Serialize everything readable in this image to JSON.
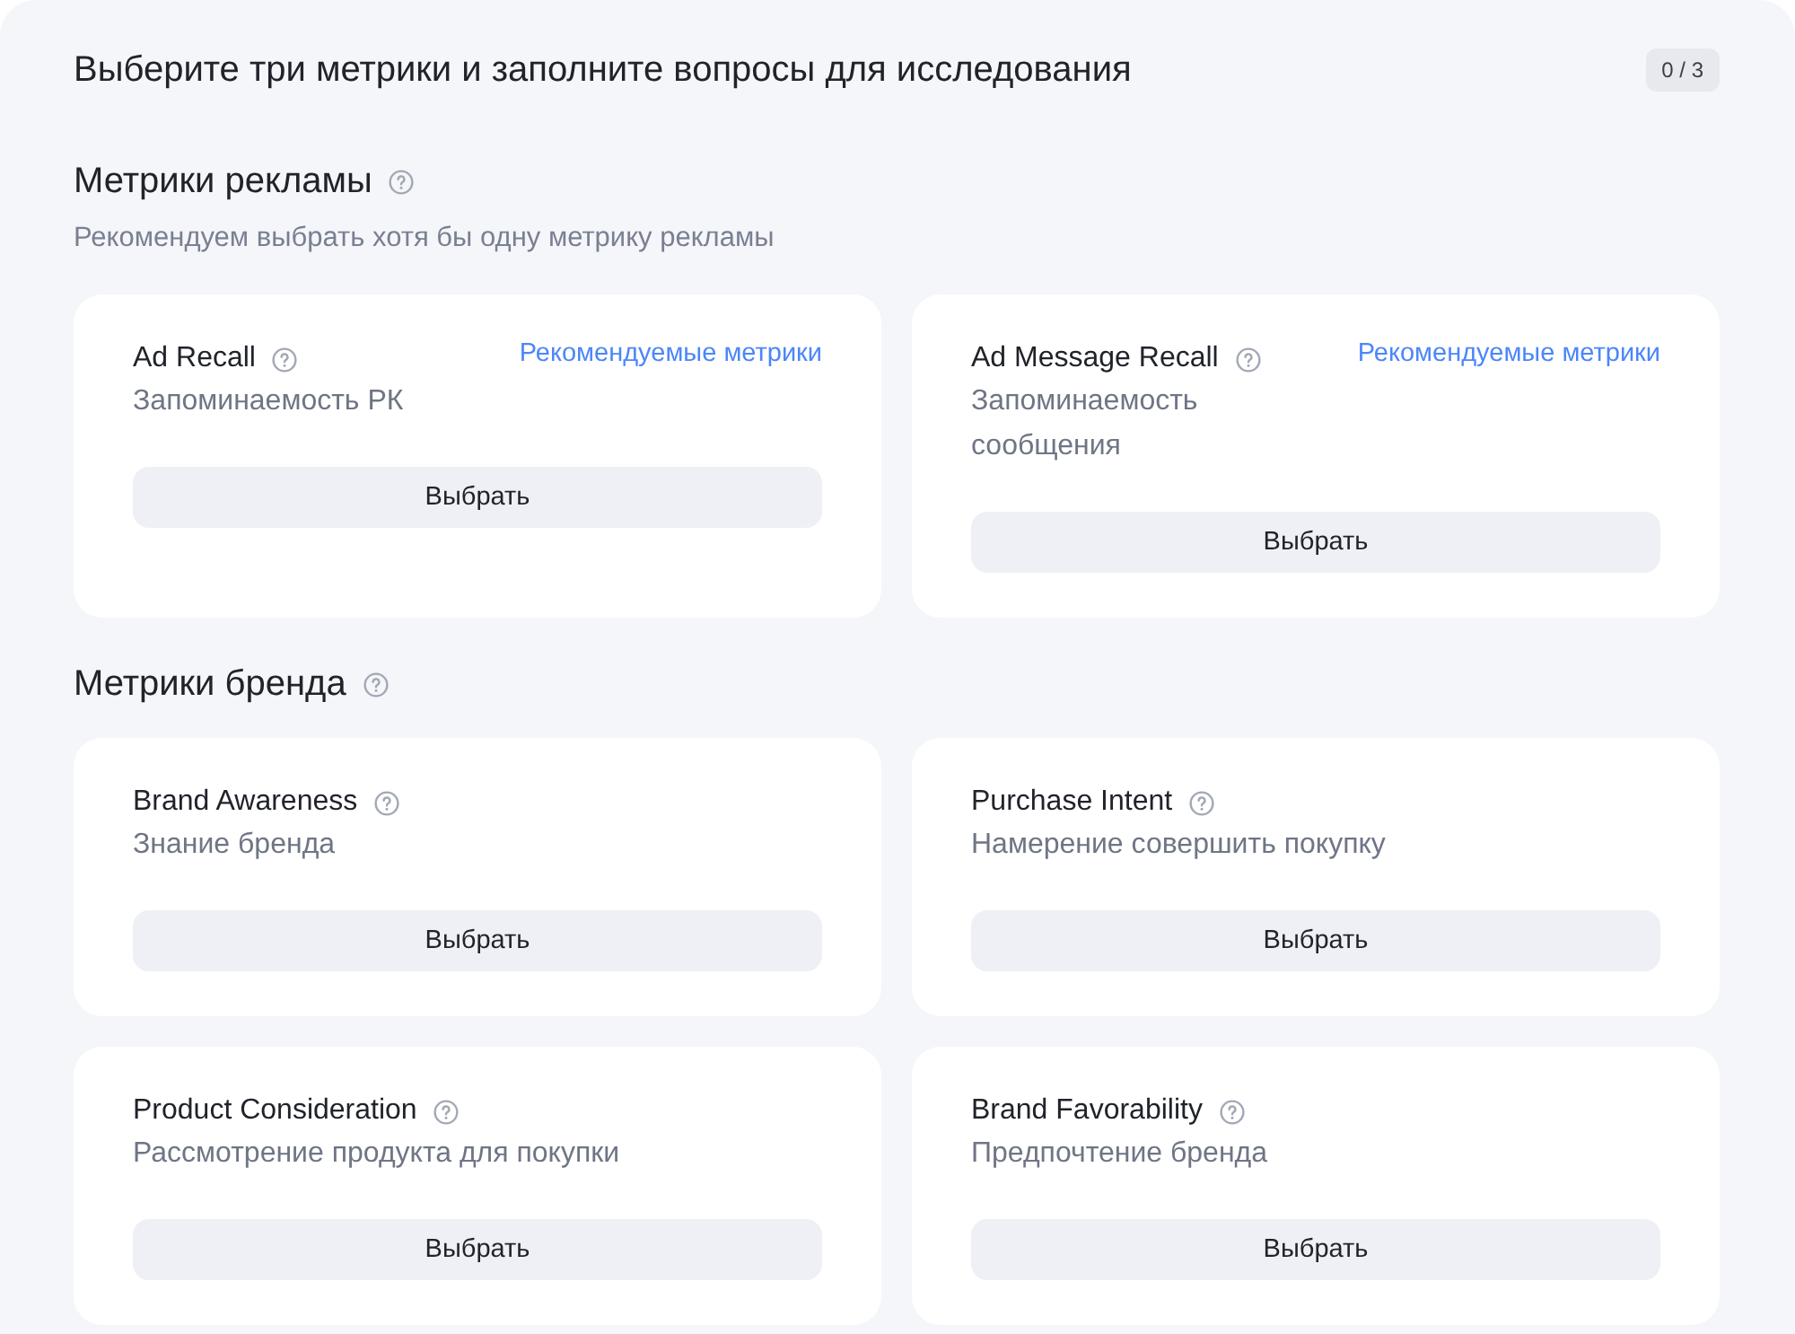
{
  "header": {
    "title": "Выберите три метрики и заполните вопросы для исследования",
    "counter": "0 / 3"
  },
  "sections": [
    {
      "title": "Метрики рекламы",
      "hint": "Рекомендуем выбрать хотя бы одну метрику рекламы",
      "cards": [
        {
          "name": "Ad Recall",
          "description": "Запоминаемость РК",
          "tag": "Рекомендуемые метрики",
          "button": "Выбрать"
        },
        {
          "name": "Ad Message Recall",
          "description": "Запоминаемость сообщения",
          "tag": "Рекомендуемые метрики",
          "button": "Выбрать"
        }
      ]
    },
    {
      "title": "Метрики бренда",
      "cards": [
        {
          "name": "Brand Awareness",
          "description": "Знание бренда",
          "button": "Выбрать"
        },
        {
          "name": "Purchase Intent",
          "description": "Намерение совершить покупку",
          "button": "Выбрать"
        },
        {
          "name": "Product Consideration",
          "description": "Рассмотрение продукта для покупки",
          "button": "Выбрать"
        },
        {
          "name": "Brand Favorability",
          "description": "Предпочтение бренда",
          "button": "Выбрать"
        }
      ]
    }
  ]
}
